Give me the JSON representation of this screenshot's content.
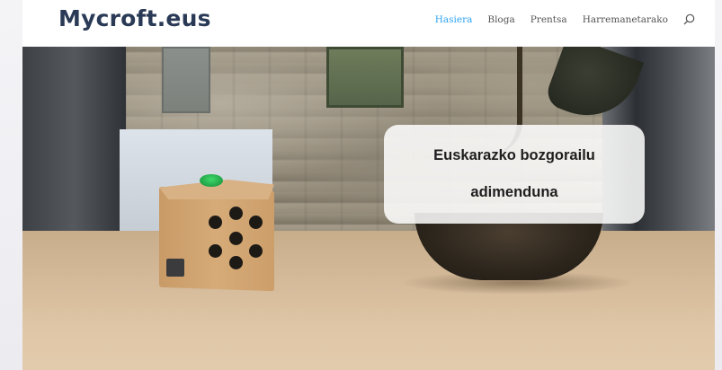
{
  "site": {
    "logo": "Mycroft.eus"
  },
  "nav": {
    "items": [
      {
        "label": "Hasiera",
        "active": true
      },
      {
        "label": "Bloga",
        "active": false
      },
      {
        "label": "Prentsa",
        "active": false
      },
      {
        "label": "Harremanetarako",
        "active": false
      }
    ],
    "search_icon": "search-icon"
  },
  "hero": {
    "heading_line1": "Euskarazko bozgorailu",
    "heading_line2": "adimenduna"
  },
  "colors": {
    "logo": "#2a3a56",
    "nav_active": "#2ea3f2",
    "nav_text": "#555555",
    "overlay_bg": "#ffffff"
  }
}
